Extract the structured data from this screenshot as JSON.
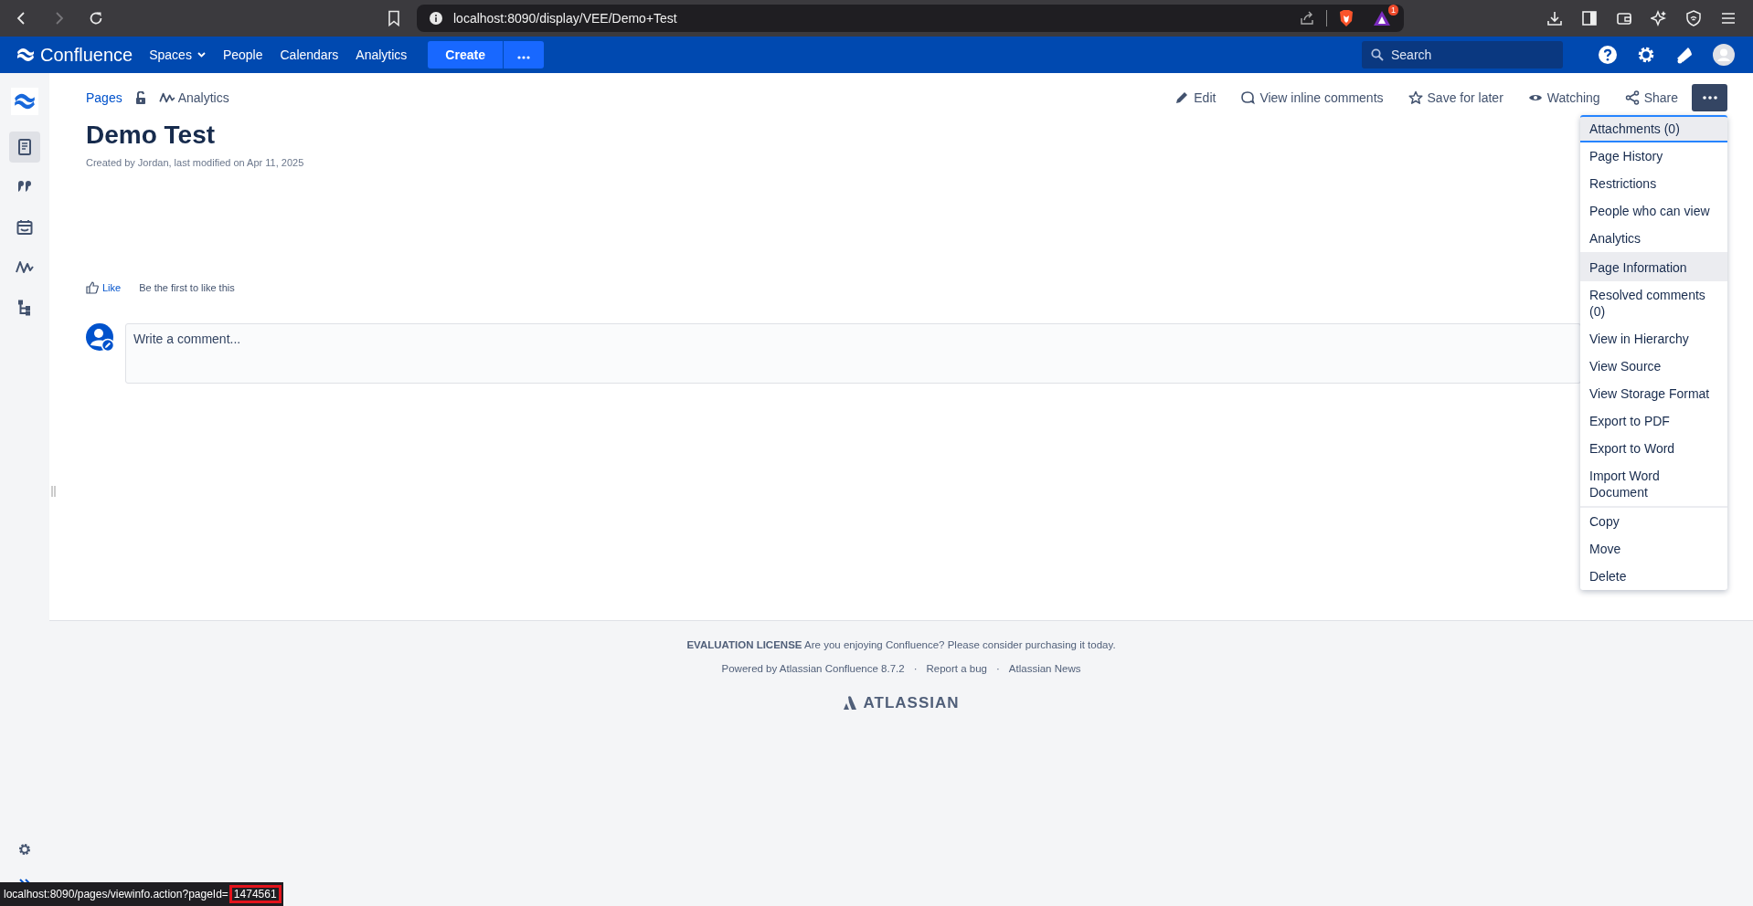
{
  "browser": {
    "back_enabled": true,
    "forward_enabled": false,
    "url": "localhost:8090/display/VEE/Demo+Test",
    "extension_badge": "1"
  },
  "nav": {
    "logo": "Confluence",
    "items": [
      {
        "label": "Spaces",
        "dropdown": true
      },
      {
        "label": "People",
        "dropdown": false
      },
      {
        "label": "Calendars",
        "dropdown": false
      },
      {
        "label": "Analytics",
        "dropdown": false
      }
    ],
    "create": "Create",
    "search": {
      "placeholder": "Search"
    }
  },
  "sidebar": {
    "items": [
      {
        "kind": "pages",
        "selected": true
      },
      {
        "kind": "blog",
        "selected": false
      },
      {
        "kind": "calendar",
        "selected": false
      },
      {
        "kind": "analytics",
        "selected": false
      },
      {
        "kind": "tree",
        "selected": false
      }
    ]
  },
  "breadcrumb": [
    {
      "kind": "link",
      "label": "Pages"
    },
    {
      "kind": "lock"
    },
    {
      "kind": "analytics",
      "label": "Analytics"
    }
  ],
  "actions": [
    {
      "kind": "edit",
      "label": "Edit"
    },
    {
      "kind": "comments",
      "label": "View inline comments"
    },
    {
      "kind": "save",
      "label": "Save for later"
    },
    {
      "kind": "watch",
      "label": "Watching"
    },
    {
      "kind": "share",
      "label": "Share"
    }
  ],
  "more_menu": {
    "open": true,
    "sections": [
      [
        {
          "label": "Attachments (0)",
          "focused": true,
          "hovered": false
        },
        {
          "label": "Page History",
          "focused": false,
          "hovered": false
        },
        {
          "label": "Restrictions",
          "focused": false,
          "hovered": false
        },
        {
          "label": "People who can view",
          "focused": false,
          "hovered": false
        },
        {
          "label": "Analytics",
          "focused": false,
          "hovered": false
        }
      ],
      [
        {
          "label": "Page Information",
          "focused": false,
          "hovered": true
        },
        {
          "label": "Resolved comments (0)",
          "focused": false,
          "hovered": false
        },
        {
          "label": "View in Hierarchy",
          "focused": false,
          "hovered": false
        },
        {
          "label": "View Source",
          "focused": false,
          "hovered": false
        },
        {
          "label": "View Storage Format",
          "focused": false,
          "hovered": false
        },
        {
          "label": "Export to PDF",
          "focused": false,
          "hovered": false
        },
        {
          "label": "Export to Word",
          "focused": false,
          "hovered": false
        },
        {
          "label": "Import Word Document",
          "focused": false,
          "hovered": false
        }
      ],
      [
        {
          "label": "Copy",
          "focused": false,
          "hovered": false
        },
        {
          "label": "Move",
          "focused": false,
          "hovered": false
        },
        {
          "label": "Delete",
          "focused": false,
          "hovered": false
        }
      ]
    ]
  },
  "page": {
    "title": "Demo Test",
    "byline": "Created by Jordan, last modified on Apr 11, 2025",
    "like": "Like",
    "like_note": "Be the first to like this",
    "comment": {
      "placeholder": "Write a comment..."
    }
  },
  "footer": {
    "license": "**EVALUATION LICENSE** Are you enjoying Confluence? Please consider purchasing it today.",
    "links": [
      "Powered by Atlassian Confluence 8.7.2",
      "Report a bug",
      "Atlassian News"
    ],
    "separator": "·",
    "brand": "ATLASSIAN"
  },
  "status_bar": {
    "url": "localhost:8090/pages/viewinfo.action?pageId=",
    "highlight": "1474561"
  }
}
